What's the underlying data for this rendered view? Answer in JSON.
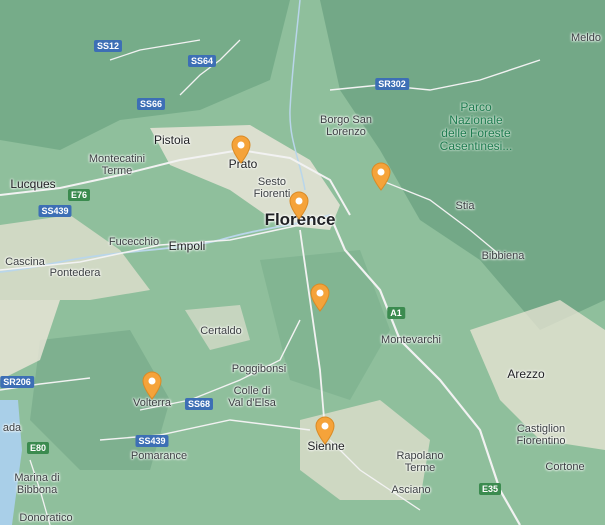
{
  "map": {
    "colors": {
      "land": "#8fbf9c",
      "urban": "#e9e4d8",
      "sea": "#a9cfe8",
      "pin": "#f5a33a",
      "pin_dot": "#ffffff"
    },
    "places": {
      "prato": "Prato",
      "florence": "Florence",
      "pistoia": "Pistoia",
      "montecatini": "Montecatini\nTerme",
      "lucques": "Lucques",
      "sesto": "Sesto\nFiorenti",
      "borgo": "Borgo San\nLorenzo",
      "park": "Parco\nNazionale\ndelle Foreste\nCasentinesi...",
      "meldo": "Meldo",
      "stia": "Stia",
      "bibbiena": "Bibbiena",
      "fucecchio": "Fucecchio",
      "empoli": "Empoli",
      "cascina": "Cascina",
      "pontedera": "Pontedera",
      "certaldo": "Certaldo",
      "poggibonsi": "Poggibonsi",
      "colle": "Colle di\nVal d'Elsa",
      "montevarchi": "Montevarchi",
      "arezzo": "Arezzo",
      "volterra": "Volterra",
      "pomarance": "Pomarance",
      "sienne": "Sienne",
      "rapolano": "Rapolano\nTerme",
      "asciano": "Asciano",
      "castiglion": "Castiglion\nFiorentino",
      "cortone": "Cortone",
      "marina": "Marina di\nBibbona",
      "donoratico": "Donoratico",
      "vada": "ada"
    },
    "roads": {
      "ss12": "SS12",
      "ss64": "SS64",
      "ss66": "SS66",
      "sr302": "SR302",
      "e76": "E76",
      "ss439a": "SS439",
      "ss439b": "SS439",
      "ss68": "SS68",
      "sr206": "SR206",
      "e80": "E80",
      "a1": "A1",
      "e35": "E35"
    },
    "pins": [
      "Prato",
      "Florence",
      "Casentino",
      "Chianti",
      "Volterra",
      "Sienne"
    ]
  }
}
